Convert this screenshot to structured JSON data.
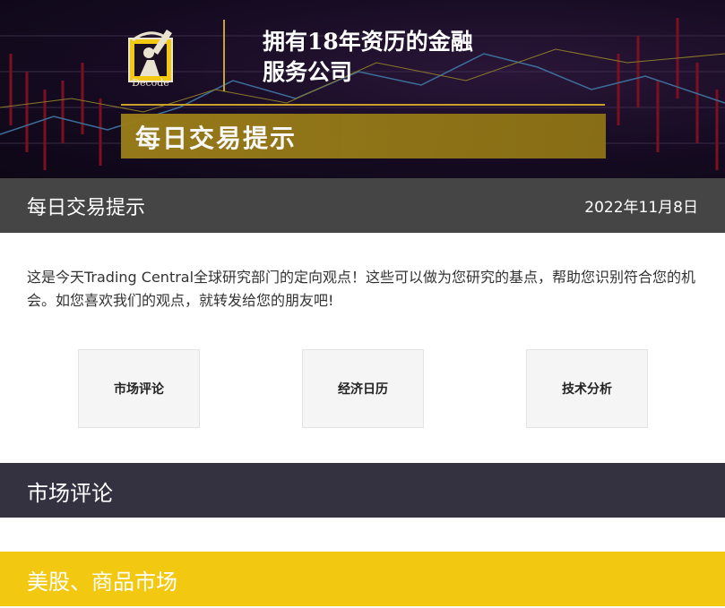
{
  "banner": {
    "logo_caption": "Decode",
    "headline_line1": "拥有18年资历的金融",
    "headline_line2": "服务公司",
    "tag": "每日交易提示"
  },
  "titlebar": {
    "title": "每日交易提示",
    "date": "2022年11月8日"
  },
  "intro": {
    "text": "这是今天Trading Central全球研究部门的定向观点！这些可以做为您研究的基点，帮助您识别符合您的机会。如您喜欢我们的观点，就转发给您的朋友吧!"
  },
  "nav": {
    "market": "市场评论",
    "calendar": "经济日历",
    "technical": "技术分析"
  },
  "sections": {
    "market_commentary": "市场评论",
    "us_stocks": "美股、商品市场"
  },
  "colors": {
    "gold": "#caa22a",
    "title_bar": "#454545",
    "section_dark": "#343241",
    "section_yellow": "#f2c810"
  }
}
